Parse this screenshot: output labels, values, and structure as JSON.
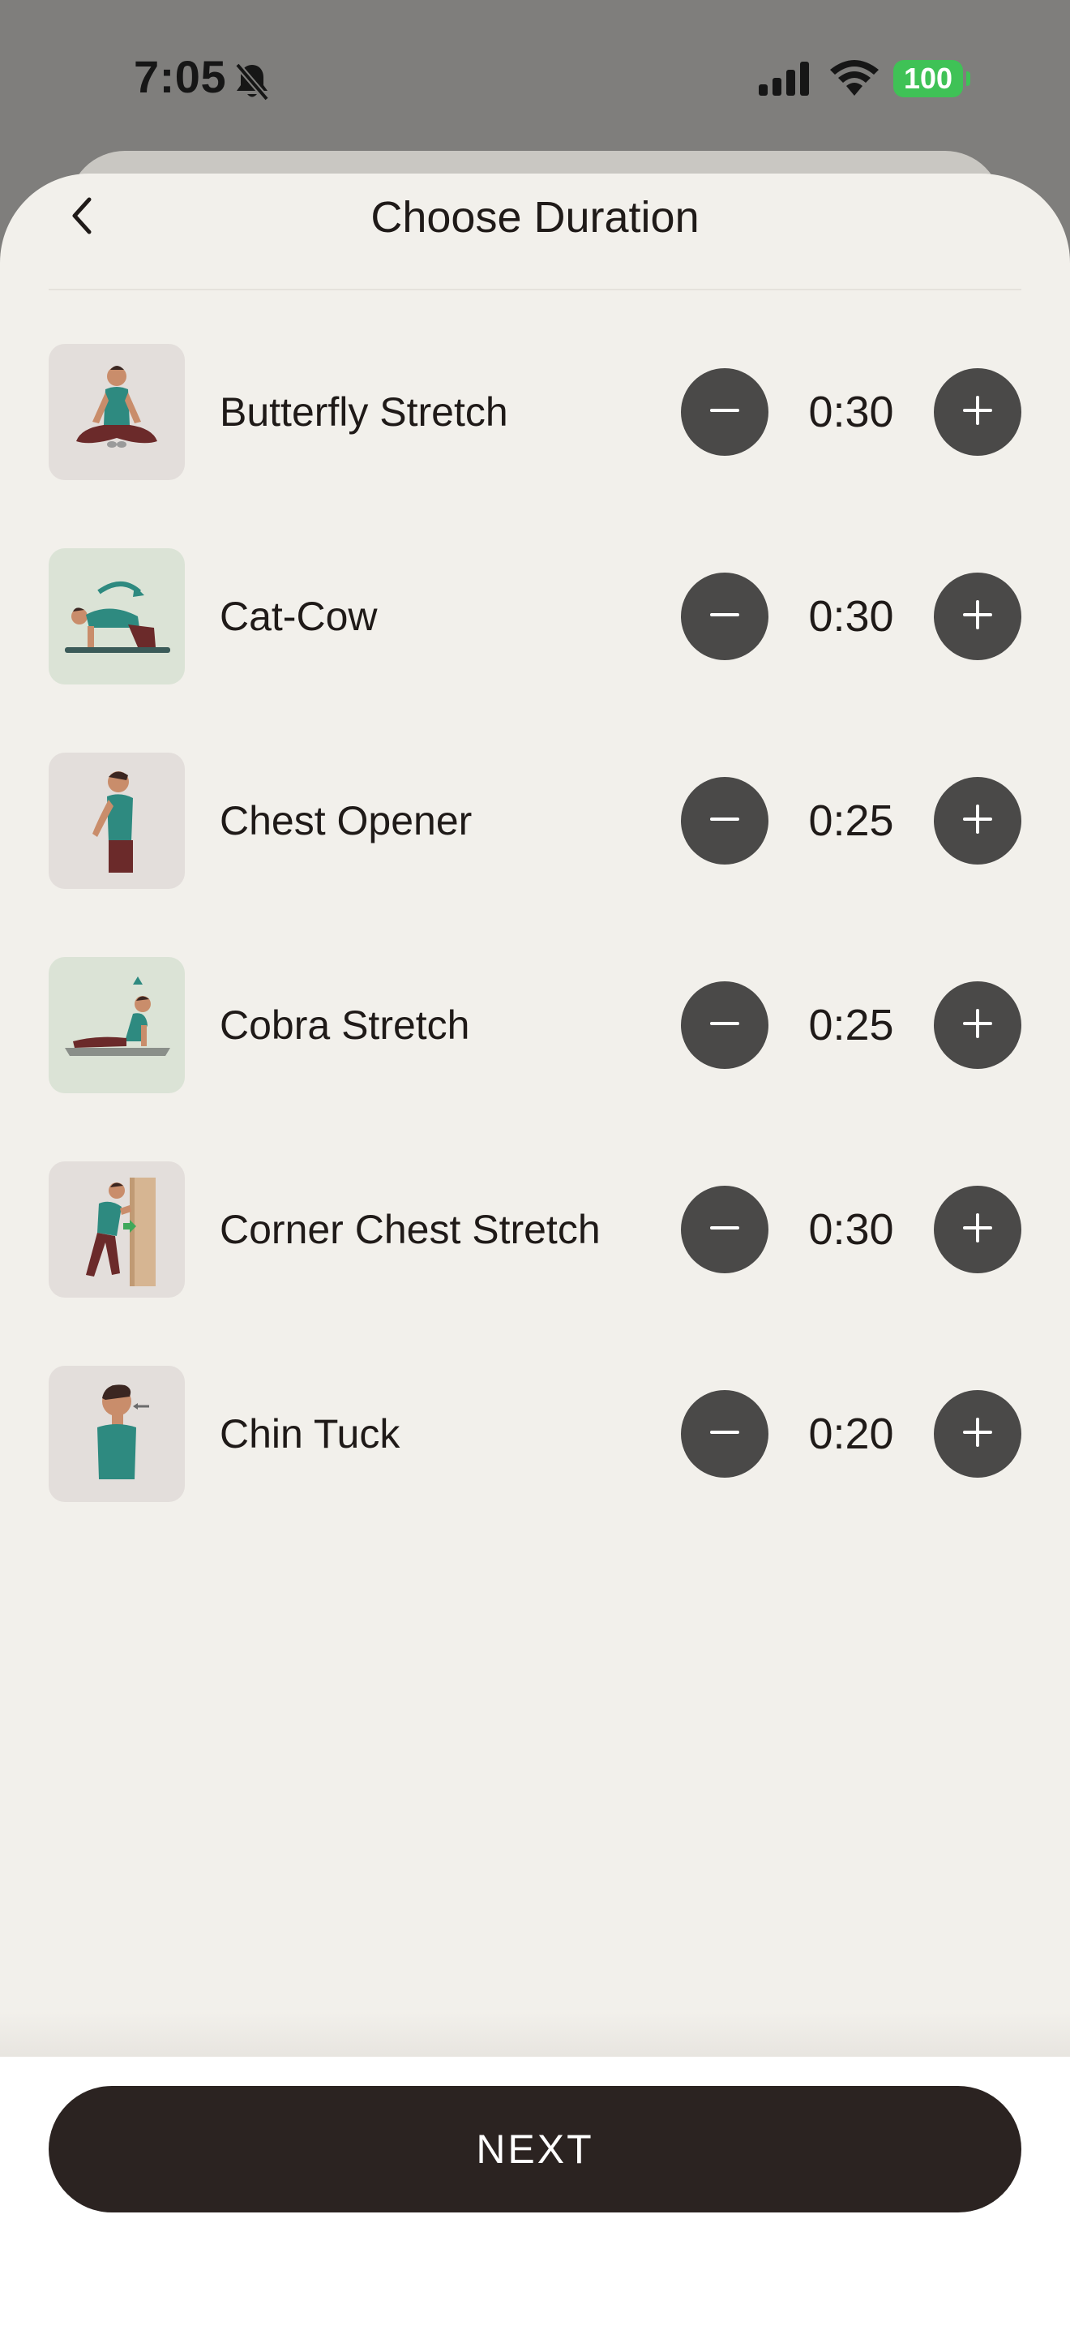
{
  "status_bar": {
    "time": "7:05",
    "battery": "100",
    "bell_icon": "bell-slash-icon",
    "signal_icon": "cellular-signal-icon",
    "wifi_icon": "wifi-icon"
  },
  "header": {
    "back_icon": "chevron-left-icon",
    "title": "Choose Duration"
  },
  "exercises": [
    {
      "name": "Butterfly Stretch",
      "duration": "0:30",
      "thumb_bg": "#e3dedb",
      "illustration": "butterfly-stretch-illustration"
    },
    {
      "name": "Cat-Cow",
      "duration": "0:30",
      "thumb_bg": "#dbe3d6",
      "illustration": "cat-cow-illustration"
    },
    {
      "name": "Chest Opener",
      "duration": "0:25",
      "thumb_bg": "#e3dedb",
      "illustration": "chest-opener-illustration"
    },
    {
      "name": "Cobra Stretch",
      "duration": "0:25",
      "thumb_bg": "#dbe3d6",
      "illustration": "cobra-stretch-illustration"
    },
    {
      "name": "Corner Chest Stretch",
      "duration": "0:30",
      "thumb_bg": "#e3dedb",
      "illustration": "corner-chest-stretch-illustration"
    },
    {
      "name": "Chin Tuck",
      "duration": "0:20",
      "thumb_bg": "#e3dedb",
      "illustration": "chin-tuck-illustration"
    }
  ],
  "controls": {
    "minus_icon": "minus-icon",
    "plus_icon": "plus-icon"
  },
  "footer": {
    "next_label": "NEXT"
  },
  "colors": {
    "background_dim": "#7f7e7c",
    "sheet": "#f2f0eb",
    "stepper_button": "#4a4948",
    "primary_button": "#2b2321",
    "battery": "#3fc256",
    "figure_teal": "#2e8a80",
    "figure_maroon": "#6b2a2a"
  }
}
